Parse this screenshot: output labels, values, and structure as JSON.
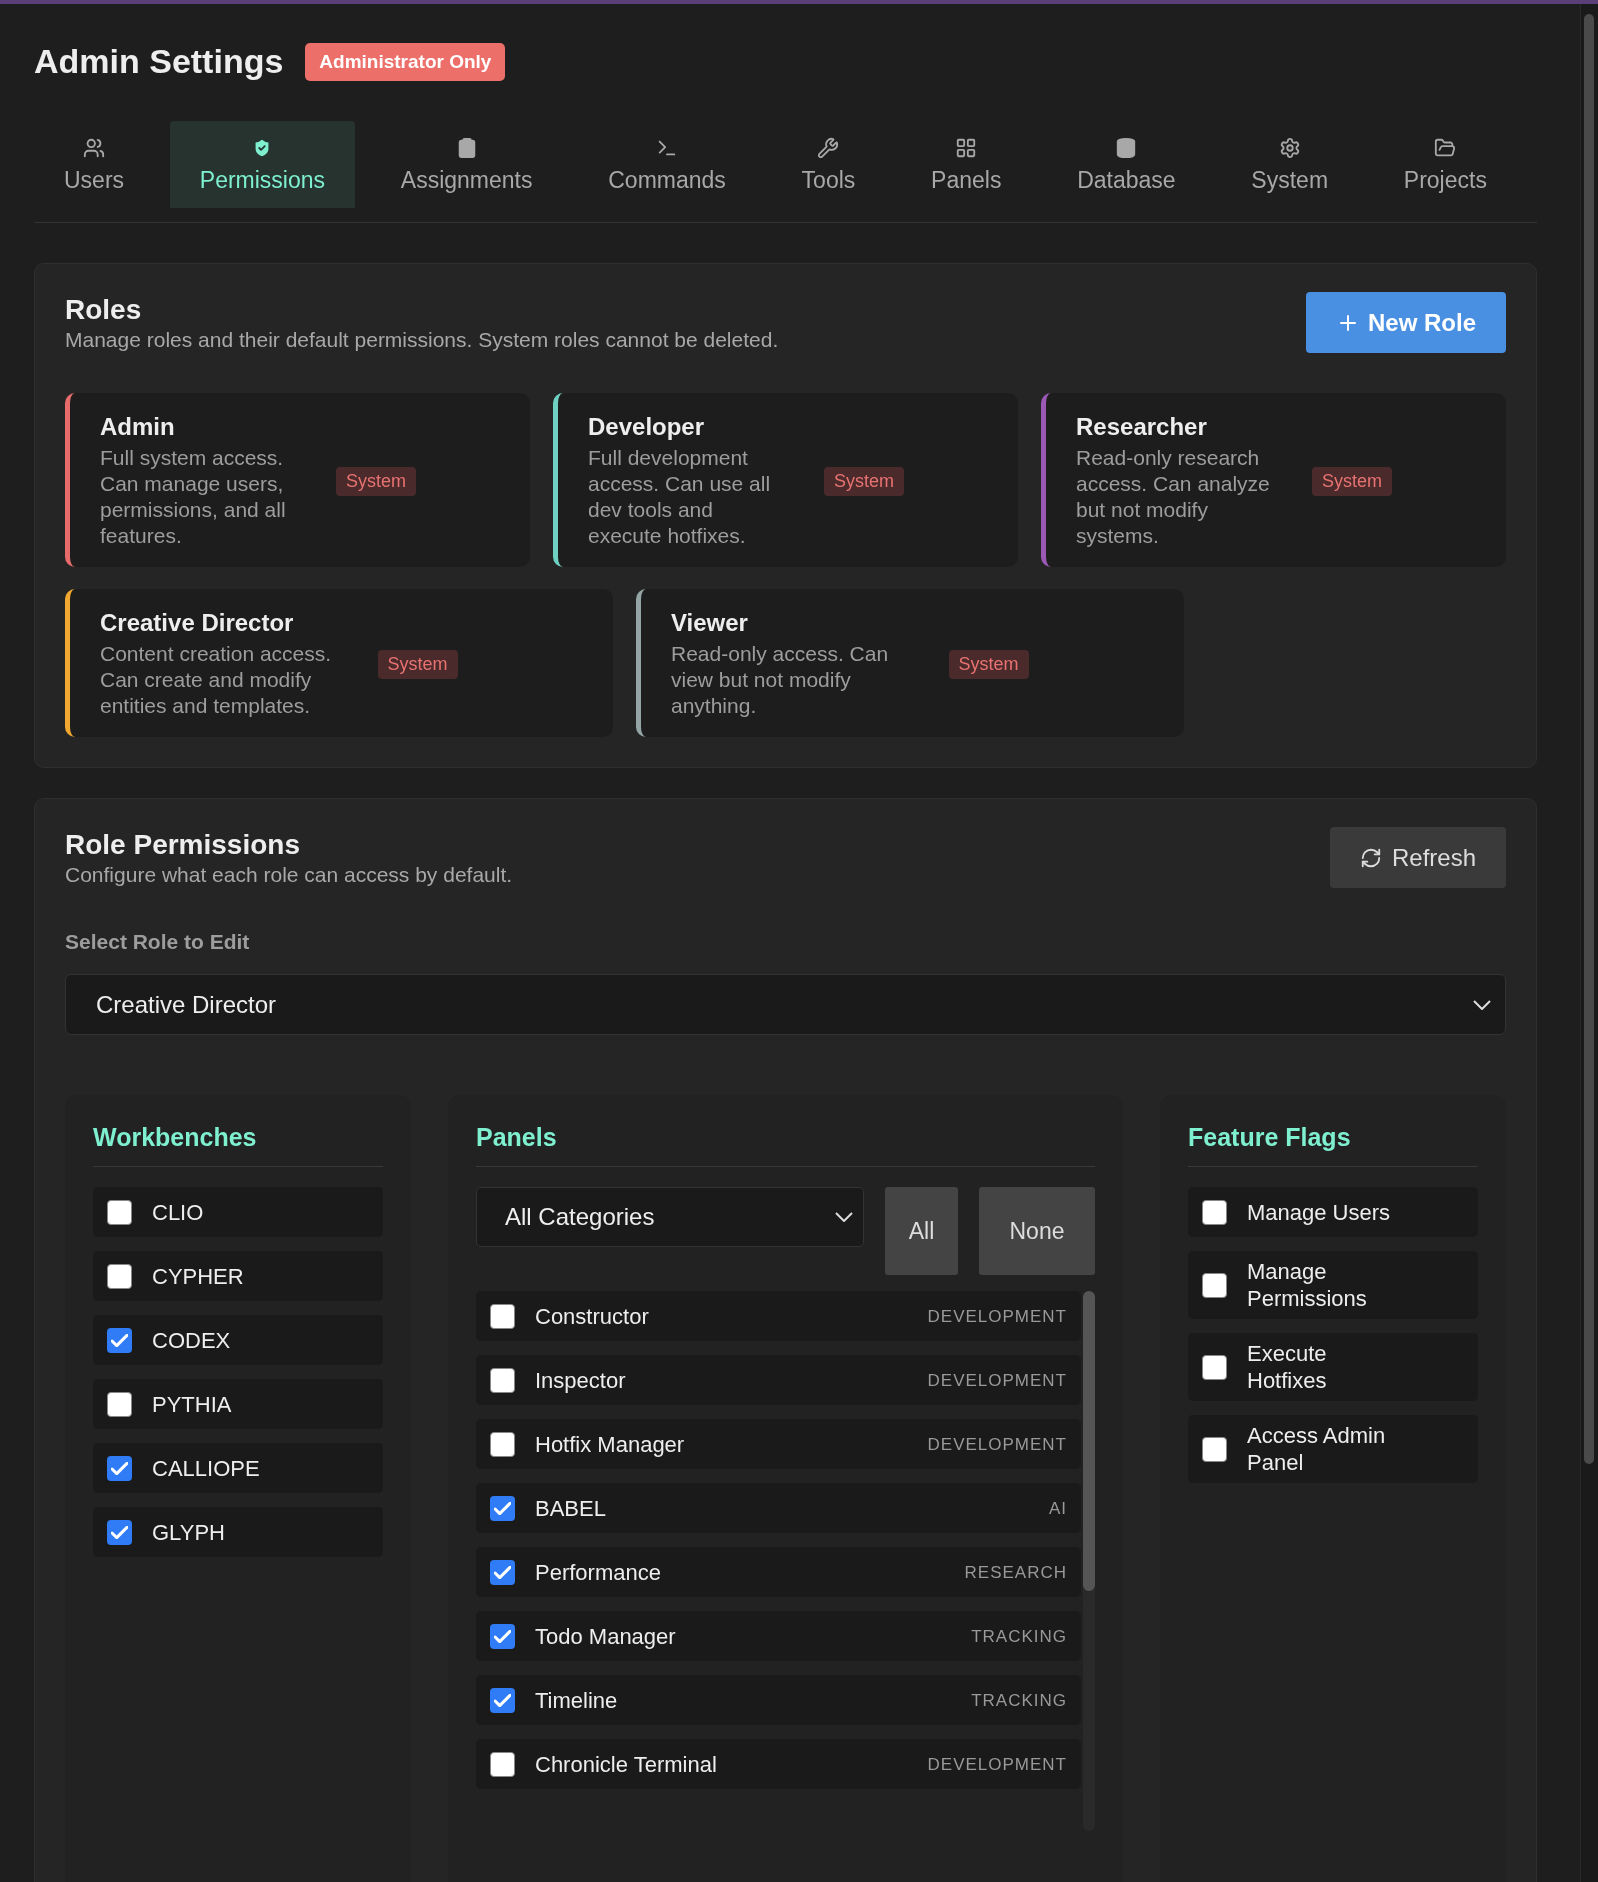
{
  "header": {
    "title": "Admin Settings",
    "badge": "Administrator Only"
  },
  "tabs": [
    {
      "label": "Users",
      "selected": false
    },
    {
      "label": "Permissions",
      "selected": true
    },
    {
      "label": "Assignments",
      "selected": false
    },
    {
      "label": "Commands",
      "selected": false
    },
    {
      "label": "Tools",
      "selected": false
    },
    {
      "label": "Panels",
      "selected": false
    },
    {
      "label": "Database",
      "selected": false
    },
    {
      "label": "System",
      "selected": false
    },
    {
      "label": "Projects",
      "selected": false
    }
  ],
  "roles": {
    "title": "Roles",
    "description": "Manage roles and their default permissions. System roles cannot be deleted.",
    "new_button": "New Role",
    "items": [
      {
        "name": "Admin",
        "description": "Full system access. Can manage users, permissions, and all features.",
        "badge": "System",
        "color": "#e86b6b"
      },
      {
        "name": "Developer",
        "description": "Full development access. Can use all dev tools and execute hotfixes.",
        "badge": "System",
        "color": "#6fd0c4"
      },
      {
        "name": "Researcher",
        "description": "Read-only research access. Can analyze but not modify systems.",
        "badge": "System",
        "color": "#9b59b6"
      },
      {
        "name": "Creative Director",
        "description": "Content creation access. Can create and modify entities and templates.",
        "badge": "System",
        "color": "#f0a830"
      },
      {
        "name": "Viewer",
        "description": "Read-only access. Can view but not modify anything.",
        "badge": "System",
        "color": "#95a5a6"
      }
    ]
  },
  "role_permissions": {
    "title": "Role Permissions",
    "description": "Configure what each role can access by default.",
    "refresh_button": "Refresh",
    "select_label": "Select Role to Edit",
    "selected_role": "Creative Director",
    "workbenches": {
      "title": "Workbenches",
      "items": [
        {
          "label": "CLIO",
          "checked": false
        },
        {
          "label": "CYPHER",
          "checked": false
        },
        {
          "label": "CODEX",
          "checked": true
        },
        {
          "label": "PYTHIA",
          "checked": false
        },
        {
          "label": "CALLIOPE",
          "checked": true
        },
        {
          "label": "GLYPH",
          "checked": true
        }
      ]
    },
    "panels": {
      "title": "Panels",
      "category_filter": "All Categories",
      "all_button": "All",
      "none_button": "None",
      "items": [
        {
          "label": "Constructor",
          "category": "DEVELOPMENT",
          "checked": false
        },
        {
          "label": "Inspector",
          "category": "DEVELOPMENT",
          "checked": false
        },
        {
          "label": "Hotfix Manager",
          "category": "DEVELOPMENT",
          "checked": false
        },
        {
          "label": "BABEL",
          "category": "AI",
          "checked": true
        },
        {
          "label": "Performance",
          "category": "RESEARCH",
          "checked": true
        },
        {
          "label": "Todo Manager",
          "category": "TRACKING",
          "checked": true
        },
        {
          "label": "Timeline",
          "category": "TRACKING",
          "checked": true
        },
        {
          "label": "Chronicle Terminal",
          "category": "DEVELOPMENT",
          "checked": false
        }
      ]
    },
    "feature_flags": {
      "title": "Feature Flags",
      "items": [
        {
          "label": "Manage Users",
          "checked": false
        },
        {
          "label": "Manage Permissions",
          "checked": false
        },
        {
          "label": "Execute Hotfixes",
          "checked": false
        },
        {
          "label": "Access Admin Panel",
          "checked": false
        }
      ]
    }
  }
}
